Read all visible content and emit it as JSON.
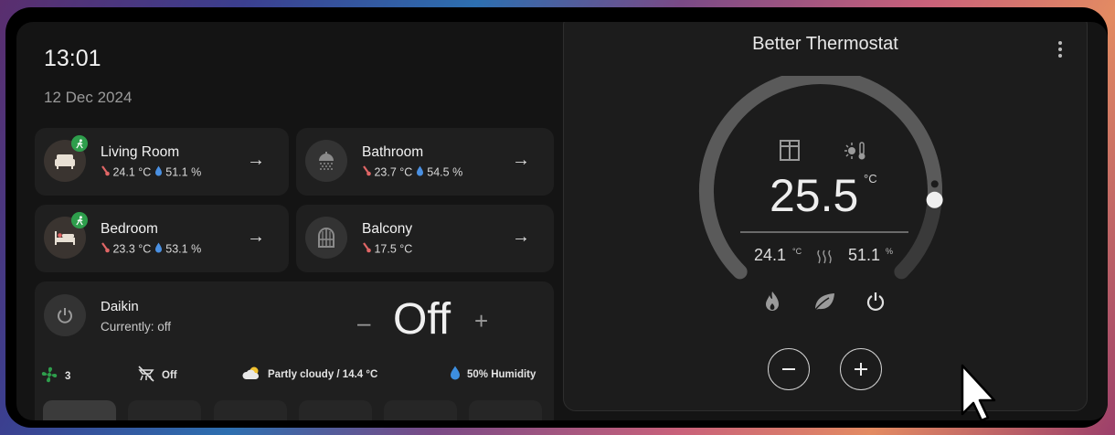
{
  "clock": {
    "time": "13:01",
    "date": "12 Dec 2024"
  },
  "rooms": [
    {
      "name": "Living Room",
      "temperature": "24.1 °C",
      "humidity": "51.1 %",
      "icon": "sofa-icon",
      "occupied": true
    },
    {
      "name": "Bathroom",
      "temperature": "23.7 °C",
      "humidity": "54.5 %",
      "icon": "shower-icon",
      "occupied": false
    },
    {
      "name": "Bedroom",
      "temperature": "23.3 °C",
      "humidity": "53.1 %",
      "icon": "bed-icon",
      "occupied": true
    },
    {
      "name": "Balcony",
      "temperature": "17.5 °C",
      "icon": "window-icon",
      "occupied": false
    }
  ],
  "climate": {
    "name": "Daikin",
    "status": "Currently: off",
    "state": "Off",
    "minus": "–",
    "plus": "+",
    "fan_speed": "3",
    "swing": "Off",
    "weather": "Partly cloudy / 14.4 °C",
    "humidity": "50% Humidity"
  },
  "thermostat": {
    "title": "Better Thermostat",
    "target": "25.5",
    "unit": "°C",
    "current_temp": "24.1",
    "current_temp_unit": "°C",
    "current_humidity": "51.1",
    "current_humidity_unit": "%",
    "setpoint_fraction": 0.85,
    "colors": {
      "arc": "#5a5a5a",
      "arc_track": "#3a3a3a",
      "accent": "#2e9e4c"
    }
  }
}
